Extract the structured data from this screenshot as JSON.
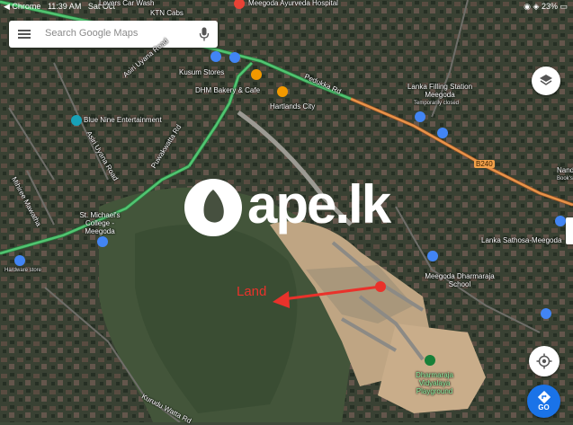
{
  "status_bar": {
    "app": "Chrome",
    "time": "11:39 AM",
    "date": "Sat Oct",
    "battery": "23%"
  },
  "search": {
    "placeholder": "Search Google Maps"
  },
  "go_button": {
    "label": "GO"
  },
  "watermark": {
    "text": "ape.lk"
  },
  "annotation": {
    "label": "Land"
  },
  "places": {
    "lovers_car_wash": "Lovers Car Wash",
    "ktn_cabs": "KTN Cabs",
    "ayurveda": "Meegoda Ayurveda Hospital",
    "kusum": "Kusum Stores",
    "dhm": "DHM Bakery & Cafe",
    "hartlands": "Hartlands City",
    "blue_nine": "Blue Nine Entertainment",
    "college": "St. Michael's College - Meegoda",
    "hardware": "Hardware store",
    "lanka_filling": "Lanka Filling Station Meegoda",
    "temp_closed": "Temporarily closed",
    "sathosa": "Lanka Sathosa-Meegoda",
    "dharmaraja_school": "Meegoda Dharmaraja School",
    "playground": "Dharmaraja Vidyalaya Playground",
    "nand": "Nand",
    "books": "Book's"
  },
  "roads": {
    "pedukka": "Pedukka Rd",
    "puwakwatta": "Puwakwatta Rd",
    "asiri1": "Asiri Uyana Road",
    "asiri2": "Asiri Uyana Road",
    "mihiree": "Mihiree Mawatha",
    "kurudu": "Kurudu Watta Rd",
    "b240": "B240"
  },
  "colors": {
    "route_green": "#52c472",
    "route_orange": "#e8934a",
    "accent_blue": "#1a73e8",
    "annotation_red": "#e9322b"
  }
}
